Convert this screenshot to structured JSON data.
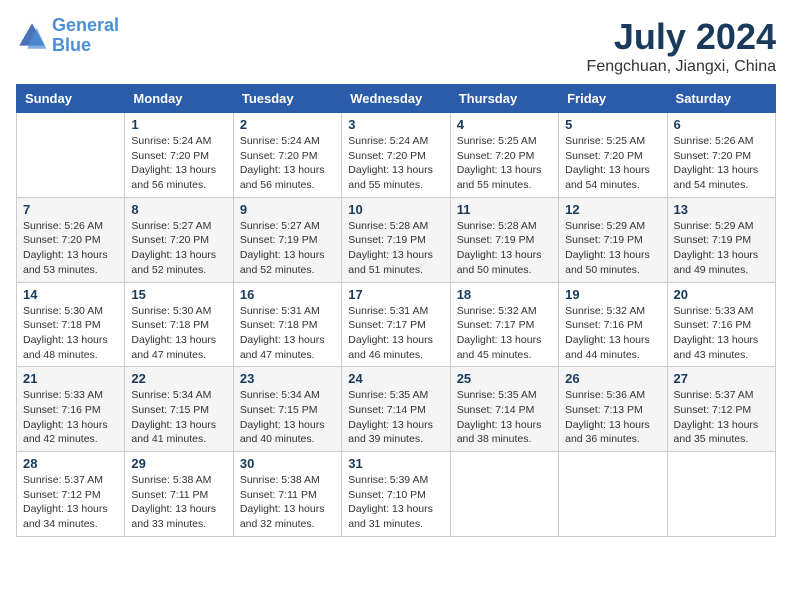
{
  "header": {
    "logo_line1": "General",
    "logo_line2": "Blue",
    "month": "July 2024",
    "location": "Fengchuan, Jiangxi, China"
  },
  "weekdays": [
    "Sunday",
    "Monday",
    "Tuesday",
    "Wednesday",
    "Thursday",
    "Friday",
    "Saturday"
  ],
  "weeks": [
    [
      {
        "day": "",
        "info": ""
      },
      {
        "day": "1",
        "info": "Sunrise: 5:24 AM\nSunset: 7:20 PM\nDaylight: 13 hours\nand 56 minutes."
      },
      {
        "day": "2",
        "info": "Sunrise: 5:24 AM\nSunset: 7:20 PM\nDaylight: 13 hours\nand 56 minutes."
      },
      {
        "day": "3",
        "info": "Sunrise: 5:24 AM\nSunset: 7:20 PM\nDaylight: 13 hours\nand 55 minutes."
      },
      {
        "day": "4",
        "info": "Sunrise: 5:25 AM\nSunset: 7:20 PM\nDaylight: 13 hours\nand 55 minutes."
      },
      {
        "day": "5",
        "info": "Sunrise: 5:25 AM\nSunset: 7:20 PM\nDaylight: 13 hours\nand 54 minutes."
      },
      {
        "day": "6",
        "info": "Sunrise: 5:26 AM\nSunset: 7:20 PM\nDaylight: 13 hours\nand 54 minutes."
      }
    ],
    [
      {
        "day": "7",
        "info": "Sunrise: 5:26 AM\nSunset: 7:20 PM\nDaylight: 13 hours\nand 53 minutes."
      },
      {
        "day": "8",
        "info": "Sunrise: 5:27 AM\nSunset: 7:20 PM\nDaylight: 13 hours\nand 52 minutes."
      },
      {
        "day": "9",
        "info": "Sunrise: 5:27 AM\nSunset: 7:19 PM\nDaylight: 13 hours\nand 52 minutes."
      },
      {
        "day": "10",
        "info": "Sunrise: 5:28 AM\nSunset: 7:19 PM\nDaylight: 13 hours\nand 51 minutes."
      },
      {
        "day": "11",
        "info": "Sunrise: 5:28 AM\nSunset: 7:19 PM\nDaylight: 13 hours\nand 50 minutes."
      },
      {
        "day": "12",
        "info": "Sunrise: 5:29 AM\nSunset: 7:19 PM\nDaylight: 13 hours\nand 50 minutes."
      },
      {
        "day": "13",
        "info": "Sunrise: 5:29 AM\nSunset: 7:19 PM\nDaylight: 13 hours\nand 49 minutes."
      }
    ],
    [
      {
        "day": "14",
        "info": "Sunrise: 5:30 AM\nSunset: 7:18 PM\nDaylight: 13 hours\nand 48 minutes."
      },
      {
        "day": "15",
        "info": "Sunrise: 5:30 AM\nSunset: 7:18 PM\nDaylight: 13 hours\nand 47 minutes."
      },
      {
        "day": "16",
        "info": "Sunrise: 5:31 AM\nSunset: 7:18 PM\nDaylight: 13 hours\nand 47 minutes."
      },
      {
        "day": "17",
        "info": "Sunrise: 5:31 AM\nSunset: 7:17 PM\nDaylight: 13 hours\nand 46 minutes."
      },
      {
        "day": "18",
        "info": "Sunrise: 5:32 AM\nSunset: 7:17 PM\nDaylight: 13 hours\nand 45 minutes."
      },
      {
        "day": "19",
        "info": "Sunrise: 5:32 AM\nSunset: 7:16 PM\nDaylight: 13 hours\nand 44 minutes."
      },
      {
        "day": "20",
        "info": "Sunrise: 5:33 AM\nSunset: 7:16 PM\nDaylight: 13 hours\nand 43 minutes."
      }
    ],
    [
      {
        "day": "21",
        "info": "Sunrise: 5:33 AM\nSunset: 7:16 PM\nDaylight: 13 hours\nand 42 minutes."
      },
      {
        "day": "22",
        "info": "Sunrise: 5:34 AM\nSunset: 7:15 PM\nDaylight: 13 hours\nand 41 minutes."
      },
      {
        "day": "23",
        "info": "Sunrise: 5:34 AM\nSunset: 7:15 PM\nDaylight: 13 hours\nand 40 minutes."
      },
      {
        "day": "24",
        "info": "Sunrise: 5:35 AM\nSunset: 7:14 PM\nDaylight: 13 hours\nand 39 minutes."
      },
      {
        "day": "25",
        "info": "Sunrise: 5:35 AM\nSunset: 7:14 PM\nDaylight: 13 hours\nand 38 minutes."
      },
      {
        "day": "26",
        "info": "Sunrise: 5:36 AM\nSunset: 7:13 PM\nDaylight: 13 hours\nand 36 minutes."
      },
      {
        "day": "27",
        "info": "Sunrise: 5:37 AM\nSunset: 7:12 PM\nDaylight: 13 hours\nand 35 minutes."
      }
    ],
    [
      {
        "day": "28",
        "info": "Sunrise: 5:37 AM\nSunset: 7:12 PM\nDaylight: 13 hours\nand 34 minutes."
      },
      {
        "day": "29",
        "info": "Sunrise: 5:38 AM\nSunset: 7:11 PM\nDaylight: 13 hours\nand 33 minutes."
      },
      {
        "day": "30",
        "info": "Sunrise: 5:38 AM\nSunset: 7:11 PM\nDaylight: 13 hours\nand 32 minutes."
      },
      {
        "day": "31",
        "info": "Sunrise: 5:39 AM\nSunset: 7:10 PM\nDaylight: 13 hours\nand 31 minutes."
      },
      {
        "day": "",
        "info": ""
      },
      {
        "day": "",
        "info": ""
      },
      {
        "day": "",
        "info": ""
      }
    ]
  ]
}
